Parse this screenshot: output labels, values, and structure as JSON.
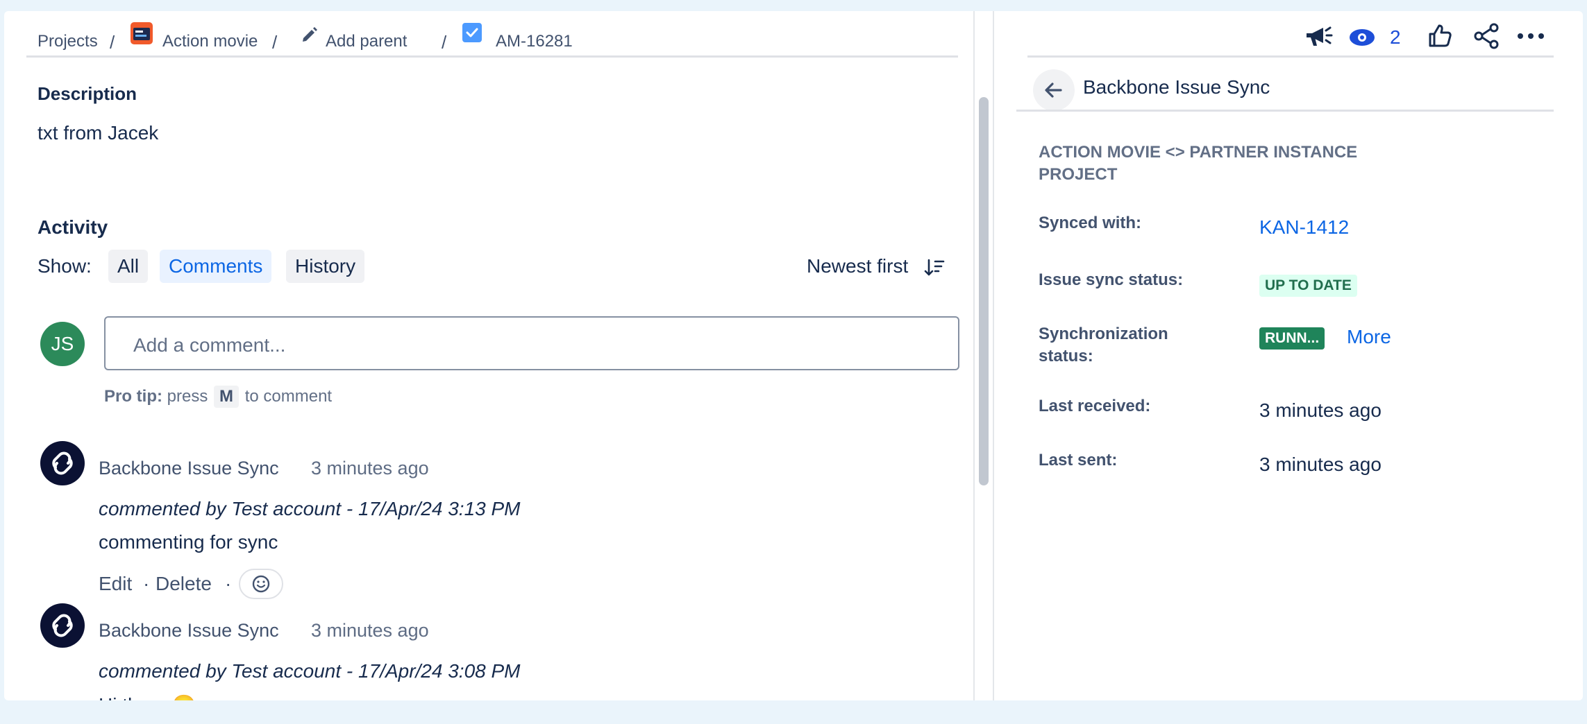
{
  "breadcrumb": {
    "projects": "Projects",
    "project_name": "Action movie",
    "add_parent": "Add parent",
    "issue_key": "AM-16281"
  },
  "description": {
    "heading": "Description",
    "text": "txt from Jacek"
  },
  "activity": {
    "heading": "Activity",
    "show_label": "Show:",
    "filters": [
      "All",
      "Comments",
      "History"
    ],
    "active_filter": "Comments",
    "sort_label": "Newest first"
  },
  "composer": {
    "avatar_initials": "JS",
    "placeholder": "Add a comment...",
    "pro_tip_bold": "Pro tip:",
    "pro_tip_press": "press",
    "pro_tip_key": "M",
    "pro_tip_rest": "to comment"
  },
  "comments": [
    {
      "author": "Backbone Issue Sync",
      "time": "3 minutes ago",
      "meta": "commented by Test account - 17/Apr/24 3:13 PM",
      "body": "commenting for sync",
      "edit": "Edit",
      "delete": "Delete",
      "separator": "·"
    },
    {
      "author": "Backbone Issue Sync",
      "time": "3 minutes ago",
      "meta": "commented by Test account - 17/Apr/24 3:08 PM",
      "body": "Hi there 🙂"
    }
  ],
  "toolbar": {
    "watch_count": "2"
  },
  "panel": {
    "title": "Backbone Issue Sync",
    "section_heading": "ACTION MOVIE <> PARTNER INSTANCE PROJECT",
    "synced_with_label": "Synced with:",
    "synced_with_value": "KAN-1412",
    "issue_sync_status_label": "Issue sync status:",
    "issue_sync_status_value": "UP TO DATE",
    "sync_status_label": "Synchronization status:",
    "sync_status_value": "RUNN...",
    "more_link": "More",
    "last_received_label": "Last received:",
    "last_received_value": "3 minutes ago",
    "last_sent_label": "Last sent:",
    "last_sent_value": "3 minutes ago"
  },
  "colors": {
    "link": "#0c66e4",
    "up_to_date_bg": "#dcfff1",
    "up_to_date_text": "#216e4e",
    "running_bg": "#1f845a",
    "avatar_green": "#2c8a5a",
    "dark_avatar": "#0b1133"
  }
}
